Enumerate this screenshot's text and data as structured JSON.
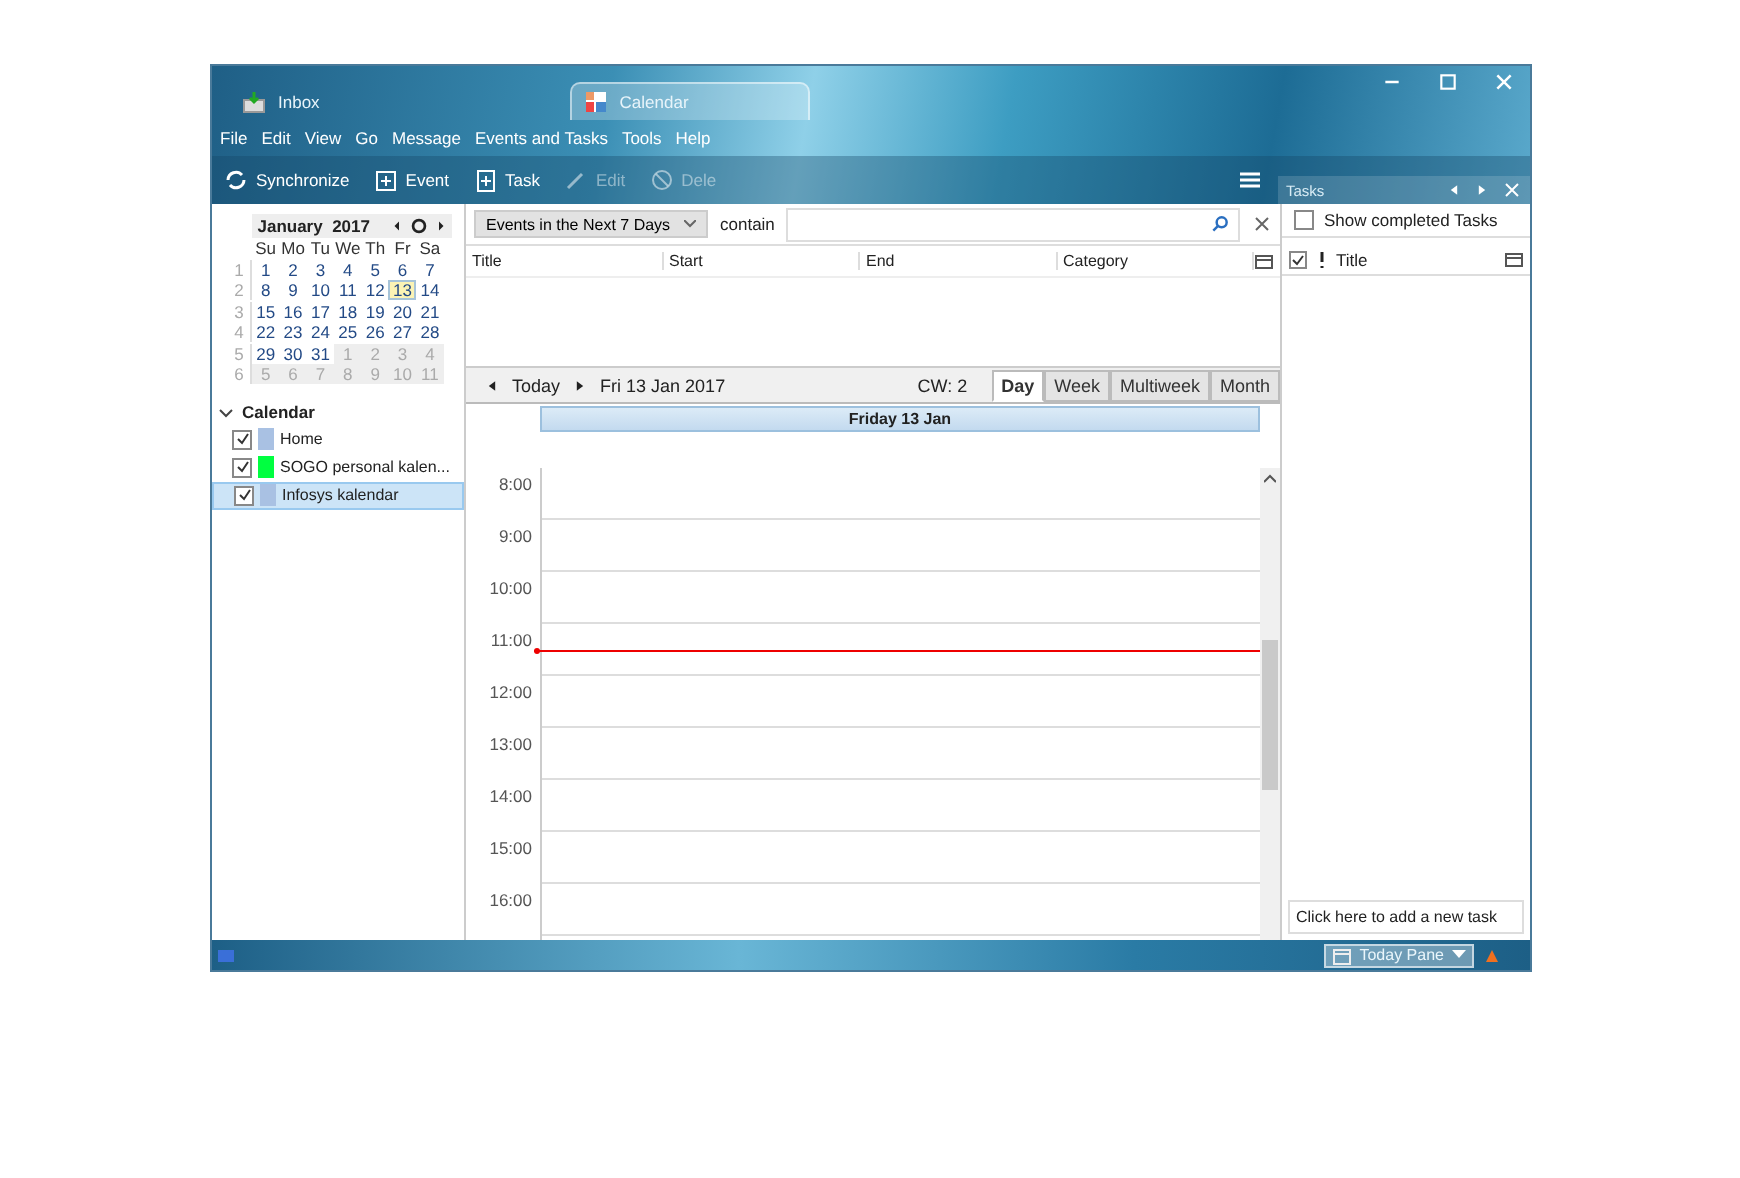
{
  "tabs": [
    {
      "label": "Inbox",
      "kind": "mail",
      "selected": false
    },
    {
      "label": "Calendar",
      "kind": "calendar",
      "selected": true
    }
  ],
  "menu": [
    "File",
    "Edit",
    "View",
    "Go",
    "Message",
    "Events and Tasks",
    "Tools",
    "Help"
  ],
  "toolbar": [
    {
      "label": "Synchronize",
      "kind": "sync",
      "disabled": false
    },
    {
      "label": "Event",
      "kind": "event",
      "disabled": false
    },
    {
      "label": "Task",
      "kind": "task",
      "disabled": false
    },
    {
      "label": "Edit",
      "kind": "edit",
      "disabled": true
    },
    {
      "label": "Dele",
      "kind": "delete",
      "disabled": true
    }
  ],
  "tasks_header": {
    "title": "Tasks"
  },
  "minimonth": {
    "month": "January",
    "year": "2017",
    "weekdays": [
      "Su",
      "Mo",
      "Tu",
      "We",
      "Th",
      "Fr",
      "Sa"
    ],
    "weeks": [
      {
        "number": "1",
        "days": [
          {
            "day": "1",
            "other_month": false,
            "today": false
          },
          {
            "day": "2",
            "other_month": false,
            "today": false
          },
          {
            "day": "3",
            "other_month": false,
            "today": false
          },
          {
            "day": "4",
            "other_month": false,
            "today": false
          },
          {
            "day": "5",
            "other_month": false,
            "today": false
          },
          {
            "day": "6",
            "other_month": false,
            "today": false
          },
          {
            "day": "7",
            "other_month": false,
            "today": false
          }
        ]
      },
      {
        "number": "2",
        "days": [
          {
            "day": "8",
            "other_month": false,
            "today": false
          },
          {
            "day": "9",
            "other_month": false,
            "today": false
          },
          {
            "day": "10",
            "other_month": false,
            "today": false
          },
          {
            "day": "11",
            "other_month": false,
            "today": false
          },
          {
            "day": "12",
            "other_month": false,
            "today": false
          },
          {
            "day": "13",
            "other_month": false,
            "today": true
          },
          {
            "day": "14",
            "other_month": false,
            "today": false
          }
        ]
      },
      {
        "number": "3",
        "days": [
          {
            "day": "15",
            "other_month": false,
            "today": false
          },
          {
            "day": "16",
            "other_month": false,
            "today": false
          },
          {
            "day": "17",
            "other_month": false,
            "today": false
          },
          {
            "day": "18",
            "other_month": false,
            "today": false
          },
          {
            "day": "19",
            "other_month": false,
            "today": false
          },
          {
            "day": "20",
            "other_month": false,
            "today": false
          },
          {
            "day": "21",
            "other_month": false,
            "today": false
          }
        ]
      },
      {
        "number": "4",
        "days": [
          {
            "day": "22",
            "other_month": false,
            "today": false
          },
          {
            "day": "23",
            "other_month": false,
            "today": false
          },
          {
            "day": "24",
            "other_month": false,
            "today": false
          },
          {
            "day": "25",
            "other_month": false,
            "today": false
          },
          {
            "day": "26",
            "other_month": false,
            "today": false
          },
          {
            "day": "27",
            "other_month": false,
            "today": false
          },
          {
            "day": "28",
            "other_month": false,
            "today": false
          }
        ]
      },
      {
        "number": "5",
        "days": [
          {
            "day": "29",
            "other_month": false,
            "today": false
          },
          {
            "day": "30",
            "other_month": false,
            "today": false
          },
          {
            "day": "31",
            "other_month": false,
            "today": false
          },
          {
            "day": "1",
            "other_month": true,
            "today": false
          },
          {
            "day": "2",
            "other_month": true,
            "today": false
          },
          {
            "day": "3",
            "other_month": true,
            "today": false
          },
          {
            "day": "4",
            "other_month": true,
            "today": false
          }
        ]
      },
      {
        "number": "6",
        "days": [
          {
            "day": "5",
            "other_month": true,
            "today": false
          },
          {
            "day": "6",
            "other_month": true,
            "today": false
          },
          {
            "day": "7",
            "other_month": true,
            "today": false
          },
          {
            "day": "8",
            "other_month": true,
            "today": false
          },
          {
            "day": "9",
            "other_month": true,
            "today": false
          },
          {
            "day": "10",
            "other_month": true,
            "today": false
          },
          {
            "day": "11",
            "other_month": true,
            "today": false
          }
        ]
      }
    ]
  },
  "calendars": {
    "title": "Calendar",
    "expanded": true,
    "items": [
      {
        "name": "Home",
        "color": "#a9c1e3",
        "checked": true,
        "selected": false
      },
      {
        "name": "SOGO personal kalen...",
        "color": "#00ff40",
        "checked": true,
        "selected": false
      },
      {
        "name": "Infosys kalendar",
        "color": "#a9c1e3",
        "checked": true,
        "selected": true
      }
    ]
  },
  "filter": {
    "range": "Events in the Next 7 Days",
    "contain_label": "contain"
  },
  "event_list": {
    "columns": [
      "Title",
      "Start",
      "End",
      "Category"
    ]
  },
  "nav": {
    "today": "Today",
    "date": "Fri 13 Jan 2017",
    "week": "CW: 2",
    "views": [
      {
        "label": "Day",
        "selected": true
      },
      {
        "label": "Week",
        "selected": false
      },
      {
        "label": "Multiweek",
        "selected": false
      },
      {
        "label": "Month",
        "selected": false
      }
    ]
  },
  "day_view": {
    "header": "Friday 13 Jan",
    "hours": [
      "8:00",
      "9:00",
      "10:00",
      "11:00",
      "12:00",
      "13:00",
      "14:00",
      "15:00",
      "16:00"
    ]
  },
  "tasks": {
    "show_completed": {
      "label": "Show completed Tasks",
      "checked": false
    },
    "column": "Title",
    "new_task_placeholder": "Click here to add a new task"
  },
  "status_bar": {
    "today_pane": "Today Pane"
  }
}
